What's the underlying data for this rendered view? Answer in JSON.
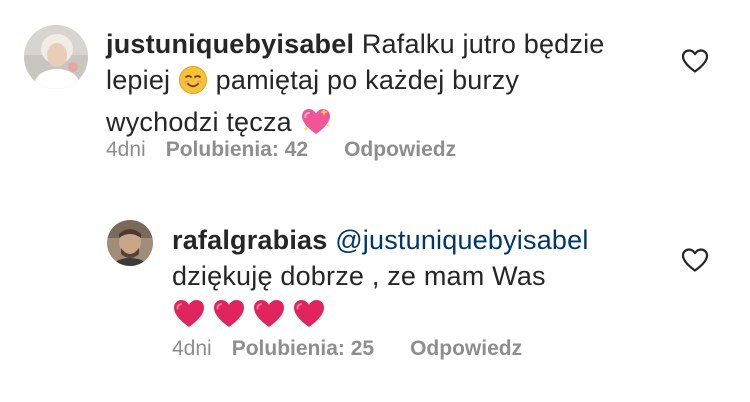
{
  "comments": [
    {
      "username": "justuniquebyisabel",
      "text_line1": "Rafalku jutro będzie",
      "text_line2a": "lepiej",
      "text_line2b": "pamiętaj po każdej burzy",
      "text_line3": "wychodzi tęcza",
      "time": "4dni",
      "likes": "Polubienia: 42",
      "reply": "Odpowiedz",
      "icons": [
        "smiling-face-emoji",
        "sparkling-heart-emoji",
        "like-heart-icon"
      ]
    },
    {
      "username": "rafalgrabias",
      "mention": "@justuniquebyisabel",
      "text_line2": "dziękuję dobrze , ze mam Was",
      "time": "4dni",
      "likes": "Polubienia: 25",
      "reply": "Odpowiedz",
      "icons": [
        "red-heart-emoji",
        "red-heart-emoji",
        "red-heart-emoji",
        "red-heart-emoji",
        "like-heart-icon"
      ]
    }
  ],
  "colors": {
    "text": "#262626",
    "meta": "#8e8e8e",
    "mention": "#00376b",
    "heart_red": "#e0245e"
  }
}
